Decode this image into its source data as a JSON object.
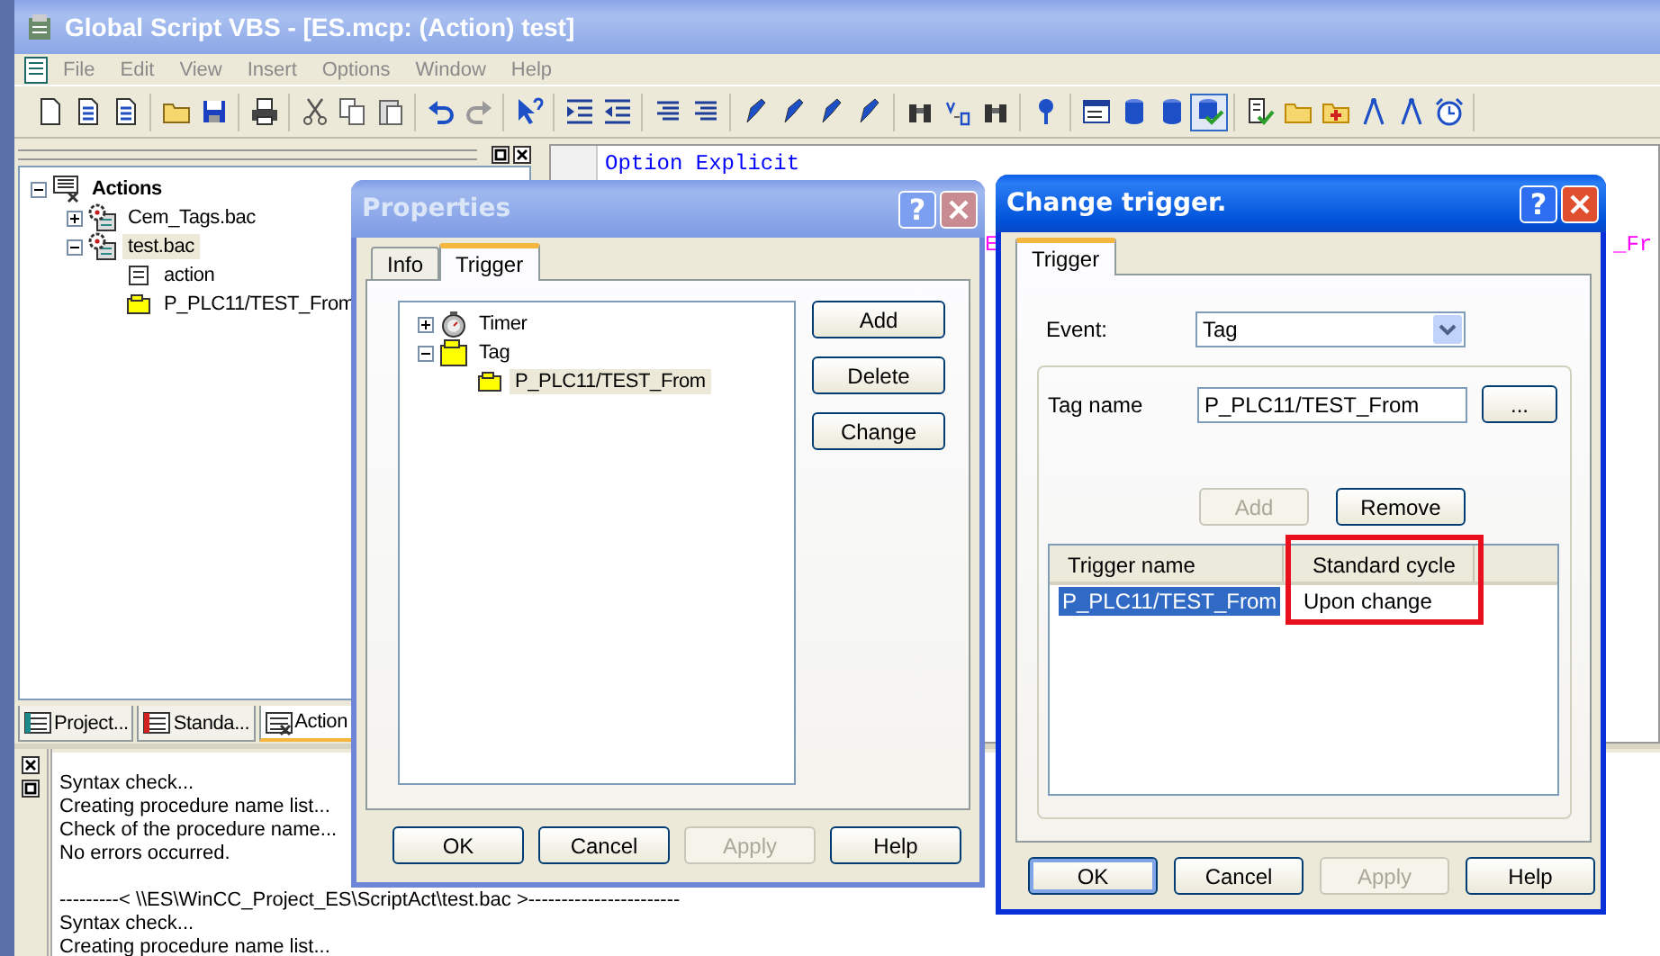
{
  "window": {
    "title": "Global Script VBS - [ES.mcp: (Action) test]",
    "active": false
  },
  "menu": [
    "File",
    "Edit",
    "View",
    "Insert",
    "Options",
    "Window",
    "Help"
  ],
  "toolbar": [
    [
      {
        "kind": "new",
        "pressed": false
      },
      {
        "kind": "doc",
        "pressed": false
      },
      {
        "kind": "doc",
        "pressed": false
      }
    ],
    [
      {
        "kind": "open",
        "pressed": false
      },
      {
        "kind": "save",
        "pressed": false
      }
    ],
    [
      {
        "kind": "print",
        "pressed": false
      }
    ],
    [
      {
        "kind": "cut",
        "pressed": false
      },
      {
        "kind": "copy",
        "pressed": false
      },
      {
        "kind": "paste",
        "pressed": false
      }
    ],
    [
      {
        "kind": "undo",
        "pressed": false
      },
      {
        "kind": "redo",
        "pressed": false
      }
    ],
    [
      {
        "kind": "pointer",
        "pressed": false
      }
    ],
    [
      {
        "kind": "indent",
        "pressed": false
      },
      {
        "kind": "outdent",
        "pressed": false
      }
    ],
    [
      {
        "kind": "lines",
        "pressed": false
      },
      {
        "kind": "lines",
        "pressed": false
      }
    ],
    [
      {
        "kind": "pen",
        "pressed": false
      },
      {
        "kind": "pen",
        "pressed": false
      },
      {
        "kind": "pen",
        "pressed": false
      },
      {
        "kind": "pen",
        "pressed": false
      }
    ],
    [
      {
        "kind": "find",
        "pressed": false
      },
      {
        "kind": "replace",
        "pressed": false
      },
      {
        "kind": "find",
        "pressed": false
      }
    ],
    [
      {
        "kind": "pin",
        "pressed": false
      }
    ],
    [
      {
        "kind": "window",
        "pressed": false
      },
      {
        "kind": "db",
        "pressed": false
      },
      {
        "kind": "db",
        "pressed": false
      },
      {
        "kind": "dbcheck",
        "pressed": true
      }
    ],
    [
      {
        "kind": "doccheck",
        "pressed": false
      },
      {
        "kind": "folder",
        "pressed": false
      },
      {
        "kind": "folderadd",
        "pressed": false
      },
      {
        "kind": "compass",
        "pressed": false
      },
      {
        "kind": "compass",
        "pressed": false
      },
      {
        "kind": "clock",
        "pressed": false
      }
    ]
  ],
  "actions_tree": [
    {
      "label": "Actions",
      "kind": "root",
      "expanded": true,
      "selected": false,
      "children": [
        {
          "label": "Cem_Tags.bac",
          "kind": "script",
          "expanded": false,
          "selected": false
        },
        {
          "label": "test.bac",
          "kind": "script",
          "expanded": true,
          "selected": true,
          "children": [
            {
              "label": "action",
              "kind": "action",
              "selected": false
            },
            {
              "label": "P_PLC11/TEST_From",
              "kind": "tag",
              "selected": false
            }
          ]
        }
      ]
    }
  ],
  "panel_tabs": [
    {
      "label": "Project...",
      "kind": "project",
      "selected": false
    },
    {
      "label": "Standa...",
      "kind": "standard",
      "selected": false
    },
    {
      "label": "Action",
      "kind": "actions",
      "selected": true
    }
  ],
  "editor": {
    "lines": [
      "Option Explicit"
    ],
    "fragments": [
      "E",
      "_Fr"
    ]
  },
  "output": [
    [
      "Syntax check...",
      "Creating procedure name list...",
      "Check of the procedure name...",
      "No errors occurred."
    ],
    [
      "---------< \\\\ES\\WinCC_Project_ES\\ScriptAct\\test.bac >-----------------------",
      "Syntax check...",
      "Creating procedure name list..."
    ]
  ],
  "properties_dialog": {
    "title": "Properties",
    "active": false,
    "help_button": "?",
    "tabs": [
      {
        "label": "Info",
        "selected": false
      },
      {
        "label": "Trigger",
        "selected": true
      }
    ],
    "tree": [
      {
        "label": "Timer",
        "kind": "timer",
        "expanded": false,
        "selected": false
      },
      {
        "label": "Tag",
        "kind": "folder",
        "expanded": true,
        "selected": false,
        "children": [
          {
            "label": "P_PLC11/TEST_From",
            "kind": "tag",
            "selected": true
          }
        ]
      }
    ],
    "side_buttons": [
      {
        "label": "Add",
        "disabled": false
      },
      {
        "label": "Delete",
        "disabled": false
      },
      {
        "label": "Change",
        "disabled": false
      }
    ],
    "buttons": [
      {
        "label": "OK",
        "disabled": false,
        "default": false
      },
      {
        "label": "Cancel",
        "disabled": false,
        "default": false
      },
      {
        "label": "Apply",
        "disabled": true,
        "default": false
      },
      {
        "label": "Help",
        "disabled": false,
        "default": false
      }
    ]
  },
  "change_trigger_dialog": {
    "title": "Change trigger.",
    "active": true,
    "help_button": "?",
    "tabs": [
      {
        "label": "Trigger",
        "selected": true
      }
    ],
    "event": {
      "label": "Event:",
      "value": "Tag"
    },
    "tag_name": {
      "label": "Tag name",
      "value": "P_PLC11/TEST_From",
      "browse_button": "..."
    },
    "list_buttons": [
      {
        "label": "Add",
        "disabled": true
      },
      {
        "label": "Remove",
        "disabled": false
      }
    ],
    "list": {
      "columns": [
        {
          "label": "Trigger name",
          "highlighted": false
        },
        {
          "label": "Standard cycle",
          "highlighted": true
        }
      ],
      "rows": [
        {
          "cells": [
            "P_PLC11/TEST_From",
            "Upon change"
          ],
          "selected": true
        }
      ]
    },
    "buttons": [
      {
        "label": "OK",
        "disabled": false,
        "default": true
      },
      {
        "label": "Cancel",
        "disabled": false,
        "default": false
      },
      {
        "label": "Apply",
        "disabled": true,
        "default": false
      },
      {
        "label": "Help",
        "disabled": false,
        "default": false
      }
    ]
  }
}
